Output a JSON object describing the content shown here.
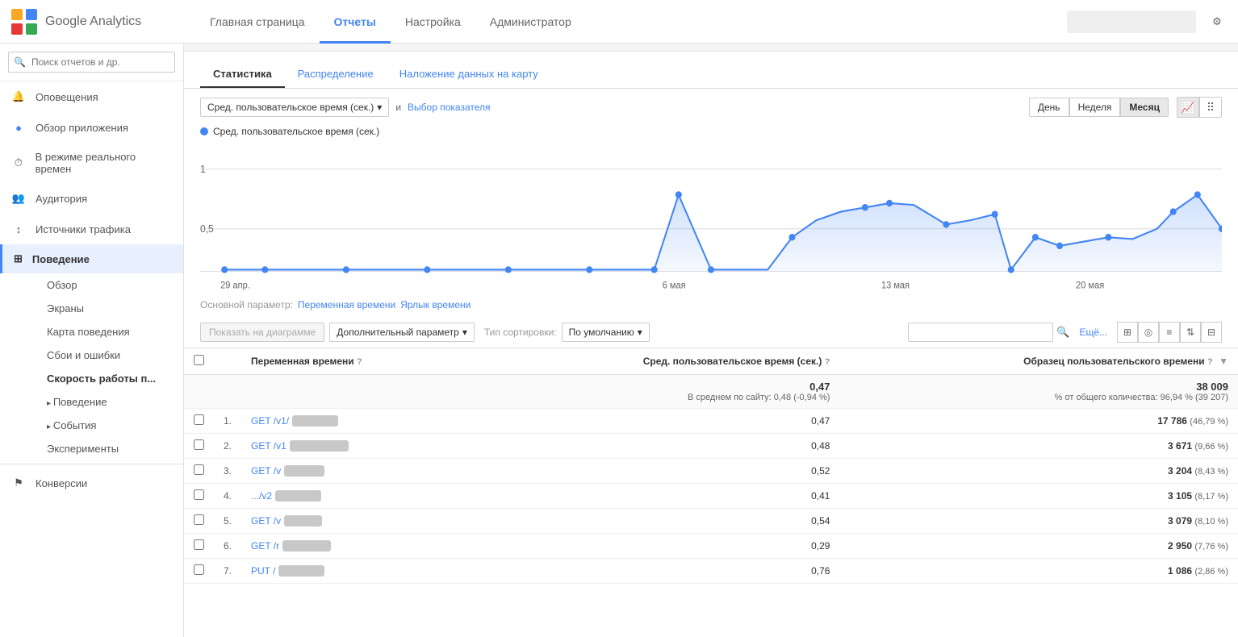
{
  "app": {
    "title": "Google Analytics",
    "logo_alt": "Google Analytics Logo"
  },
  "nav": {
    "links": [
      {
        "id": "home",
        "label": "Главная страница",
        "active": false
      },
      {
        "id": "reports",
        "label": "Отчеты",
        "active": true
      },
      {
        "id": "settings",
        "label": "Настройка",
        "active": false
      },
      {
        "id": "admin",
        "label": "Администратор",
        "active": false
      }
    ]
  },
  "sidebar": {
    "search_placeholder": "Поиск отчетов и др.",
    "items": [
      {
        "id": "alerts",
        "label": "Оповещения",
        "icon": "bell"
      },
      {
        "id": "app-overview",
        "label": "Обзор приложения",
        "icon": "circle",
        "active": false
      },
      {
        "id": "realtime",
        "label": "В режиме реального времен",
        "icon": "clock"
      },
      {
        "id": "audience",
        "label": "Аудитория",
        "icon": "people"
      },
      {
        "id": "traffic",
        "label": "Источники трафика",
        "icon": "arrows"
      },
      {
        "id": "behavior",
        "label": "Поведение",
        "icon": "grid",
        "active": true
      },
      {
        "id": "conversions",
        "label": "Конверсии",
        "icon": "flag"
      }
    ],
    "behavior_sub": [
      {
        "id": "overview",
        "label": "Обзор"
      },
      {
        "id": "screens",
        "label": "Экраны"
      },
      {
        "id": "behavior-map",
        "label": "Карта поведения"
      },
      {
        "id": "crashes",
        "label": "Сбои и ошибки"
      },
      {
        "id": "speed",
        "label": "Скорость работы п...",
        "active": true
      },
      {
        "id": "behavior-sub",
        "label": "Поведение",
        "arrow": true
      },
      {
        "id": "events-sub",
        "label": "События",
        "arrow": true
      },
      {
        "id": "experiments",
        "label": "Эксперименты"
      }
    ]
  },
  "tabs": [
    {
      "id": "stats",
      "label": "Статистика",
      "active": true
    },
    {
      "id": "distribution",
      "label": "Распределение",
      "active": false
    },
    {
      "id": "map",
      "label": "Наложение данных на карту",
      "active": false
    }
  ],
  "chart": {
    "metric_label": "Сред. пользовательское время (сек.)",
    "metric_dot_color": "#4285f4",
    "y_labels": [
      "1",
      "0,5"
    ],
    "x_labels": [
      "29 апр.",
      "6 мая",
      "13 мая",
      "20 мая"
    ],
    "period_buttons": [
      "День",
      "Неделя",
      "Месяц"
    ],
    "active_period": "Месяц",
    "and_text": "и",
    "metric_selector_label": "Сред. пользовательское время (сек.)",
    "add_metric_label": "Выбор показателя"
  },
  "table_controls": {
    "show_on_chart": "Показать на диаграмме",
    "add_param": "Дополнительный параметр",
    "sort_label": "Тип сортировки:",
    "sort_value": "По умолчанию",
    "more_label": "Ещё..."
  },
  "primary_param": {
    "label": "Основной параметр:",
    "current": "Переменная времени",
    "alt": "Ярлык времени"
  },
  "table": {
    "headers": [
      {
        "id": "check",
        "label": ""
      },
      {
        "id": "num",
        "label": ""
      },
      {
        "id": "variable",
        "label": "Переменная времени",
        "help": true
      },
      {
        "id": "avg_time",
        "label": "Сред. пользовательское время (сек.)",
        "help": true
      },
      {
        "id": "sample",
        "label": "Образец пользовательского времени",
        "help": true,
        "sort": true
      }
    ],
    "summary": {
      "avg_time": "0,47",
      "avg_sub": "В среднем по сайту: 0,48 (-0,94 %)",
      "sample": "38 009",
      "sample_sub": "% от общего количества: 96,94 % (39 207)"
    },
    "rows": [
      {
        "num": "1.",
        "link": "GET /v1/",
        "blurred": true,
        "avg_time": "0,47",
        "sample": "17 786",
        "sample_pct": "46,79 %"
      },
      {
        "num": "2.",
        "link": "GET /v1",
        "blurred": true,
        "avg_time": "0,48",
        "sample": "3 671",
        "sample_pct": "9,66 %"
      },
      {
        "num": "3.",
        "link": "GET /v",
        "blurred": true,
        "avg_time": "0,52",
        "sample": "3 204",
        "sample_pct": "8,43 %"
      },
      {
        "num": "4.",
        "link": ".../v2",
        "blurred": true,
        "avg_time": "0,41",
        "sample": "3 105",
        "sample_pct": "8,17 %"
      },
      {
        "num": "5.",
        "link": "GET /v",
        "blurred": true,
        "avg_time": "0,54",
        "sample": "3 079",
        "sample_pct": "8,10 %"
      },
      {
        "num": "6.",
        "link": "GET /r",
        "blurred": true,
        "avg_time": "0,29",
        "sample": "2 950",
        "sample_pct": "7,76 %"
      },
      {
        "num": "7.",
        "link": "PUT /",
        "blurred": true,
        "avg_time": "0,76",
        "sample": "1 086",
        "sample_pct": "2,86 %"
      }
    ]
  },
  "colors": {
    "brand_blue": "#4285f4",
    "active_nav": "#4285f4",
    "sidebar_active_bg": "#e8f0fe"
  }
}
